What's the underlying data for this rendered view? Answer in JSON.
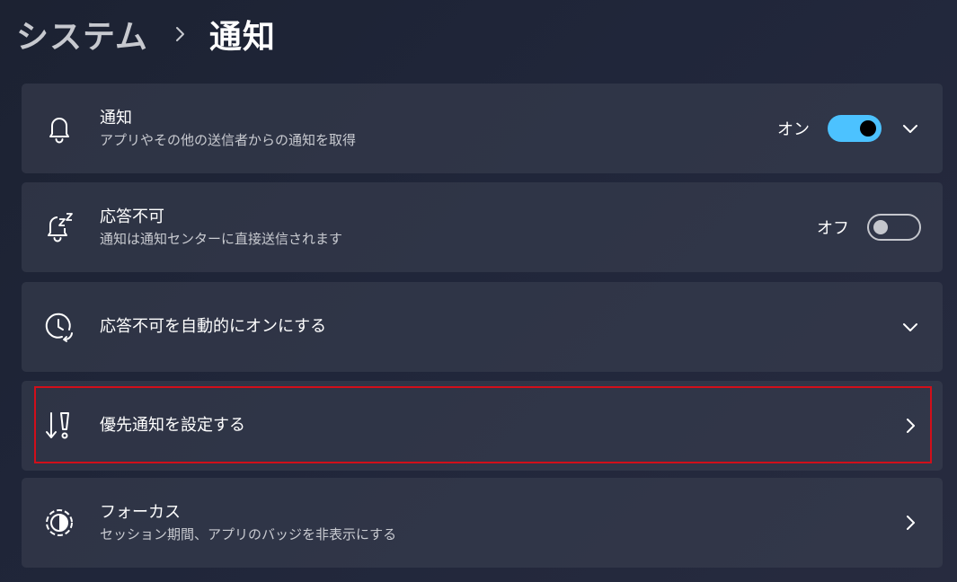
{
  "breadcrumb": {
    "parent": "システム",
    "separator_icon": "chevron-right-icon",
    "current": "通知"
  },
  "settings": [
    {
      "icon": "bell-icon",
      "title": "通知",
      "subtitle": "アプリやその他の送信者からの通知を取得",
      "toggle_state": "オン",
      "toggle_on": true,
      "action_icon": "chevron-down-icon"
    },
    {
      "icon": "bell-snooze-icon",
      "title": "応答不可",
      "subtitle": "通知は通知センターに直接送信されます",
      "toggle_state": "オフ",
      "toggle_on": false
    },
    {
      "icon": "clock-refresh-icon",
      "title": "応答不可を自動的にオンにする",
      "action_icon": "chevron-down-icon"
    },
    {
      "icon": "priority-icon",
      "title": "優先通知を設定する",
      "action_icon": "chevron-right-icon",
      "highlighted": true
    },
    {
      "icon": "focus-icon",
      "title": "フォーカス",
      "subtitle": "セッション期間、アプリのバッジを非表示にする",
      "action_icon": "chevron-right-icon"
    }
  ],
  "colors": {
    "accent": "#4cc2ff",
    "highlight_border": "#d10f1a"
  }
}
